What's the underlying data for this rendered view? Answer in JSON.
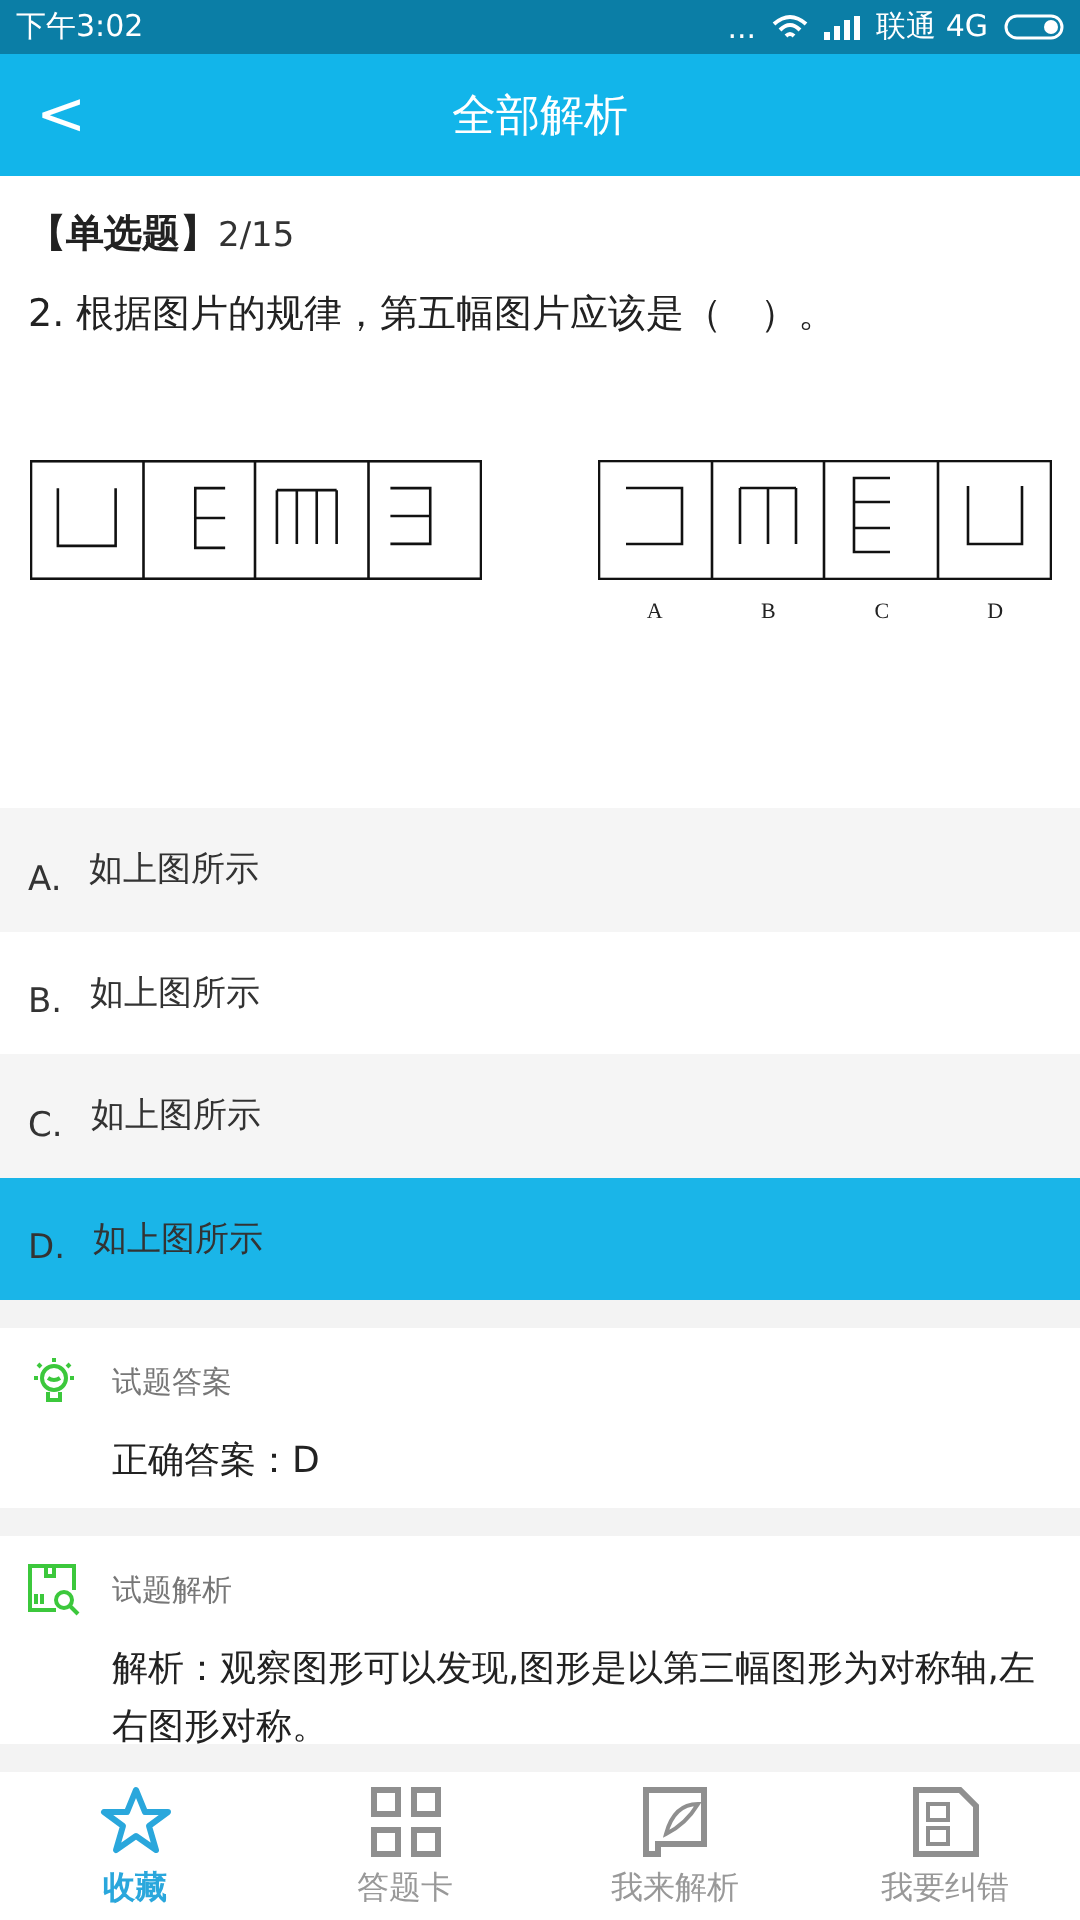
{
  "status_bar": {
    "time": "下午3:02",
    "dots": "...",
    "carrier": "联通 4G"
  },
  "header": {
    "back": "<",
    "title": "全部解析"
  },
  "question": {
    "type_label": "【单选题】",
    "progress": "2/15",
    "text": "2. 根据图片的规律，第五幅图片应该是（　）。",
    "figure_labels": [
      "A",
      "B",
      "C",
      "D"
    ]
  },
  "options": [
    {
      "letter": "A.",
      "text": "如上图所示",
      "selected": false
    },
    {
      "letter": "B.",
      "text": "如上图所示",
      "selected": false
    },
    {
      "letter": "C.",
      "text": "如上图所示",
      "selected": false
    },
    {
      "letter": "D.",
      "text": "如上图所示",
      "selected": true
    }
  ],
  "answer": {
    "heading": "试题答案",
    "text": "正确答案：D"
  },
  "analysis": {
    "heading": "试题解析",
    "text": "解析：观察图形可以发现,图形是以第三幅图形为对称轴,左右图形对称。"
  },
  "tab_bar": [
    {
      "label": "收藏",
      "kind": "star",
      "selected": true
    },
    {
      "label": "答题卡",
      "kind": "grid",
      "selected": false
    },
    {
      "label": "我来解析",
      "kind": "quill",
      "selected": false
    },
    {
      "label": "我要纠错",
      "kind": "form",
      "selected": false
    }
  ]
}
